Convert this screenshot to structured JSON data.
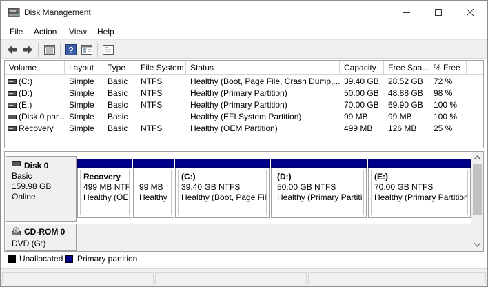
{
  "window": {
    "title": "Disk Management",
    "icons": {
      "app": "disk-management-icon",
      "minimize": "minimize-icon",
      "maximize": "maximize-icon",
      "close": "close-icon"
    }
  },
  "menu": [
    "File",
    "Action",
    "View",
    "Help"
  ],
  "toolbar": {
    "buttons": [
      "back-arrow-icon",
      "forward-arrow-icon",
      "disk-list-icon",
      "help-icon",
      "properties-icon",
      "console-icon"
    ]
  },
  "volume_table": {
    "columns": [
      "Volume",
      "Layout",
      "Type",
      "File System",
      "Status",
      "Capacity",
      "Free Spa...",
      "% Free"
    ],
    "rows": [
      {
        "volume": "(C:)",
        "layout": "Simple",
        "type": "Basic",
        "fs": "NTFS",
        "status": "Healthy (Boot, Page File, Crash Dump,...",
        "capacity": "39.40 GB",
        "free": "28.52 GB",
        "pct": "72 %"
      },
      {
        "volume": "(D:)",
        "layout": "Simple",
        "type": "Basic",
        "fs": "NTFS",
        "status": "Healthy (Primary Partition)",
        "capacity": "50.00 GB",
        "free": "48.88 GB",
        "pct": "98 %"
      },
      {
        "volume": "(E:)",
        "layout": "Simple",
        "type": "Basic",
        "fs": "NTFS",
        "status": "Healthy (Primary Partition)",
        "capacity": "70.00 GB",
        "free": "69.90 GB",
        "pct": "100 %"
      },
      {
        "volume": "(Disk 0 par...",
        "layout": "Simple",
        "type": "Basic",
        "fs": "",
        "status": "Healthy (EFI System Partition)",
        "capacity": "99 MB",
        "free": "99 MB",
        "pct": "100 %"
      },
      {
        "volume": "Recovery",
        "layout": "Simple",
        "type": "Basic",
        "fs": "NTFS",
        "status": "Healthy (OEM Partition)",
        "capacity": "499 MB",
        "free": "126 MB",
        "pct": "25 %"
      }
    ]
  },
  "disks": [
    {
      "name": "Disk 0",
      "lines": [
        "Basic",
        "159.98 GB",
        "Online"
      ],
      "partitions": [
        {
          "title": "Recovery",
          "line1": "499 MB NTF",
          "line2": "Healthy (OEI"
        },
        {
          "title": "",
          "line1": "99 MB",
          "line2": "Healthy"
        },
        {
          "title": "(C:)",
          "line1": "39.40 GB NTFS",
          "line2": "Healthy (Boot, Page File"
        },
        {
          "title": "(D:)",
          "line1": "50.00 GB NTFS",
          "line2": "Healthy (Primary Partiti"
        },
        {
          "title": "(E:)",
          "line1": "70.00 GB NTFS",
          "line2": "Healthy (Primary Partition"
        }
      ]
    },
    {
      "name": "CD-ROM 0",
      "lines": [
        "DVD (G:)"
      ]
    }
  ],
  "legend": [
    {
      "label": "Unallocated",
      "color": "#000000"
    },
    {
      "label": "Primary partition",
      "color": "#00008b"
    }
  ],
  "colors": {
    "primary_partition": "#00008b",
    "unallocated": "#000000"
  }
}
